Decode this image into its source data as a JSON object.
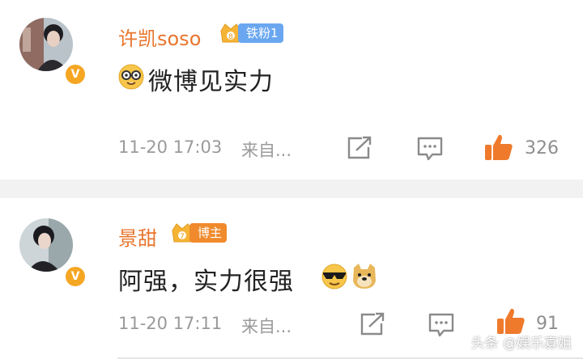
{
  "comments": [
    {
      "username": "许凯soso",
      "fan_badge": "铁粉1",
      "text": "微博见实力",
      "timestamp": "11-20 17:03",
      "source": "来自...",
      "likes": "326",
      "avatar_icon": "verified-v-icon",
      "emoji_icons": [
        "nerd-glasses-emoji"
      ]
    },
    {
      "username": "景甜",
      "fan_badge": "博主",
      "text": "阿强，实力很强",
      "timestamp": "11-20 17:11",
      "source": "来自...",
      "likes": "91",
      "avatar_icon": "verified-v-icon",
      "emoji_icons": [
        "sunglasses-emoji",
        "doge-emoji"
      ]
    }
  ],
  "watermark": "头条 @娱乐寡姐",
  "colors": {
    "username": "#e8752d",
    "fan_badge_iron": "#6aa7f0",
    "fan_badge_blogger": "#f08a2c",
    "like_icon": "#ef7a2c",
    "verified_badge": "#f5a623",
    "divider": "#f2f2f2"
  }
}
